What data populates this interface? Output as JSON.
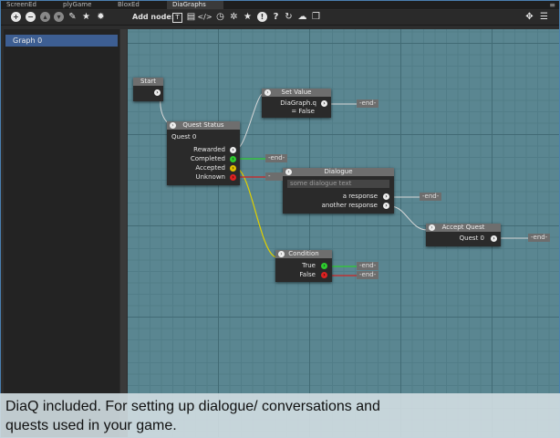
{
  "tabs": [
    "ScreenEd",
    "plyGame",
    "BloxEd",
    "DiaGraphs"
  ],
  "active_tab": "DiaGraphs",
  "tab_menu_icon": "menu-icon",
  "toolbar": {
    "left_icons": [
      "add-icon",
      "remove-icon",
      "move-up-icon",
      "move-down-icon"
    ],
    "more_icons": [
      "edit-icon",
      "star-icon",
      "settings-icon"
    ],
    "add_node_label": "Add node:",
    "node_icons": [
      "text-node-icon",
      "document-icon",
      "code-icon",
      "clock-icon",
      "bug-icon",
      "star-icon",
      "alert-icon",
      "help-icon",
      "refresh-icon",
      "chat-icon",
      "cube-icon"
    ],
    "right_icons": [
      "move-icon",
      "list-icon"
    ]
  },
  "sidebar": {
    "items": [
      "Graph 0"
    ]
  },
  "nodes": {
    "start": {
      "title": "Start"
    },
    "quest_status": {
      "title": "Quest Status",
      "subtitle": "Quest 0",
      "outputs": [
        "Rewarded",
        "Completed",
        "Accepted",
        "Unknown"
      ]
    },
    "set_value": {
      "title": "Set Value",
      "line1": "DiaGraph.q",
      "line2": "= False"
    },
    "dialogue": {
      "title": "Dialogue",
      "text": "some dialogue text",
      "responses": [
        "a response",
        "another response"
      ]
    },
    "condition": {
      "title": "Condition",
      "outputs": [
        "True",
        "False"
      ]
    },
    "accept_quest": {
      "title": "Accept Quest",
      "output": "Quest 0"
    }
  },
  "end_label": "-end-",
  "caption": {
    "line1": "DiaQ included. For setting up dialogue/ conversations and",
    "line2": "quests used in your game."
  },
  "colors": {
    "canvas": "#5a8691",
    "selected": "#3d5e92",
    "wire_green": "#2fcc2f",
    "wire_yellow": "#e0d000",
    "wire_red": "#d22222"
  }
}
